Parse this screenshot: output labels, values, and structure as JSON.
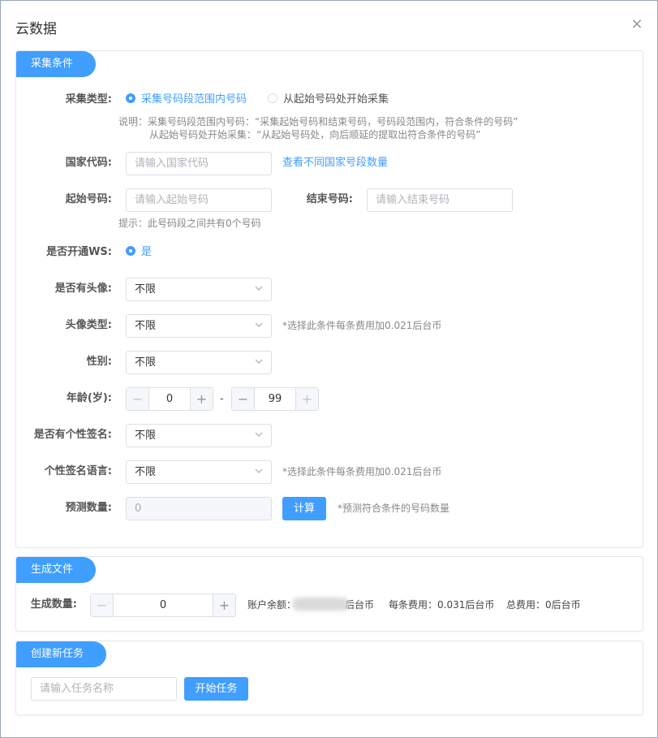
{
  "dialog": {
    "title": "云数据",
    "close_label": "×"
  },
  "collect": {
    "tab": "采集条件",
    "type_label": "采集类型:",
    "type_opt1": "采集号码段范围内号码",
    "type_opt2": "从起始号码处开始采集",
    "desc_line1": "说明：采集号码段范围内号码：“采集起始号码和结束号码，号码段范围内，符合条件的号码”",
    "desc_line2": "从起始号码处开始采集：“从起始号码处，向后顺延的提取出符合条件的号码”",
    "country_label": "国家代码:",
    "country_placeholder": "请输入国家代码",
    "country_link": "查看不同国家号段数量",
    "start_label": "起始号码:",
    "start_placeholder": "请输入起始号码",
    "end_label": "结束号码:",
    "end_placeholder": "请输入结束号码",
    "range_hint": "提示：此号码段之间共有0个号码",
    "ws_label": "是否开通WS:",
    "ws_opt": "是",
    "avatar_label": "是否有头像:",
    "avatar_value": "不限",
    "avatar_type_label": "头像类型:",
    "avatar_type_value": "不限",
    "avatar_type_hint": "*选择此条件每条费用加0.021后台币",
    "gender_label": "性别:",
    "gender_value": "不限",
    "age_label": "年龄(岁):",
    "age_min": "0",
    "age_max": "99",
    "age_sep": "-",
    "sig_label": "是否有个性签名:",
    "sig_value": "不限",
    "sig_lang_label": "个性签名语言:",
    "sig_lang_value": "不限",
    "sig_lang_hint": "*选择此条件每条费用加0.021后台币",
    "predict_label": "预测数量:",
    "predict_value": "0",
    "calc_button": "计算",
    "predict_hint": "*预测符合条件的号码数量",
    "minus": "−",
    "plus": "+"
  },
  "generate": {
    "tab": "生成文件",
    "count_label": "生成数量:",
    "count_value": "0",
    "balance_prefix": "账户余额：",
    "balance_suffix": "后台币",
    "per_cost": "每条费用：0.031后台币",
    "total_cost": "总费用：0后台币"
  },
  "task": {
    "tab": "创建新任务",
    "name_placeholder": "请输入任务名称",
    "start_button": "开始任务"
  }
}
